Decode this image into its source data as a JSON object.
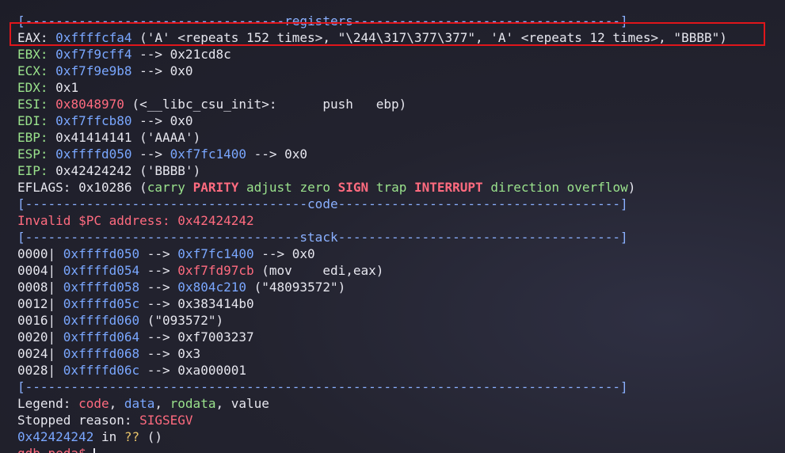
{
  "colors": {
    "background": "#23232f",
    "text": "#e6e6ee",
    "blue": "#7aa7ff",
    "header": "#8ab0ff",
    "red": "#ff6b7f",
    "green": "#9ae28c",
    "yellow": "#e9c46a",
    "highlight_box": "#e0161b"
  },
  "sections": {
    "registers": "[----------------------------------registers-----------------------------------]",
    "code": "[-------------------------------------code-------------------------------------]",
    "stack": "[------------------------------------stack-------------------------------------]",
    "end": "[------------------------------------------------------------------------------]"
  },
  "registers": {
    "eax": {
      "label": "EAX: ",
      "value": "0xffffcfa4",
      "desc": " ('A' <repeats 152 times>, \"\\244\\317\\377\\377\", 'A' <repeats 12 times>, \"BBBB\")"
    },
    "ebx": {
      "label": "EBX: ",
      "value": "0xf7f9cff4",
      "desc": " --> 0x21cd8c"
    },
    "ecx": {
      "label": "ECX: ",
      "value": "0xf7f9e9b8",
      "desc": " --> 0x0"
    },
    "edx": {
      "label": "EDX: ",
      "value": "0x1"
    },
    "esi": {
      "label": "ESI: ",
      "value": "0x8048970",
      "desc": " (<__libc_csu_init>:      push   ebp)"
    },
    "edi": {
      "label": "EDI: ",
      "value": "0xf7ffcb80",
      "desc": " --> 0x0"
    },
    "ebp": {
      "label": "EBP: ",
      "value": "0x41414141 ('AAAA')"
    },
    "esp": {
      "label": "ESP: ",
      "value": "0xffffd050",
      "arrow1": " --> ",
      "value2": "0xf7fc1400",
      "desc": " --> 0x0"
    },
    "eip": {
      "label": "EIP: ",
      "value": "0x42424242 ('BBBB')"
    },
    "eflags": {
      "label": "EFLAGS: ",
      "value": "0x10286 (",
      "flags": [
        "carry",
        "PARITY",
        "adjust",
        "zero",
        "SIGN",
        "trap",
        "INTERRUPT",
        "direction",
        "overflow"
      ],
      "close": ")"
    }
  },
  "code": {
    "message": "Invalid $PC address: 0x42424242"
  },
  "stack": [
    {
      "offset": "0000| ",
      "addr": "0xffffd050",
      "arrow": " --> ",
      "val": "0xf7fc1400",
      "rest": " --> 0x0"
    },
    {
      "offset": "0004| ",
      "addr": "0xffffd054",
      "arrow": " --> ",
      "val": "0xf7fd97cb",
      "rest": " (mov    edi,eax)"
    },
    {
      "offset": "0008| ",
      "addr": "0xffffd058",
      "arrow": " --> ",
      "val": "0x804c210",
      "rest": " (\"48093572\")"
    },
    {
      "offset": "0012| ",
      "addr": "0xffffd05c",
      "rest": " --> 0x383414b0"
    },
    {
      "offset": "0016| ",
      "addr": "0xffffd060",
      "rest": " (\"093572\")"
    },
    {
      "offset": "0020| ",
      "addr": "0xffffd064",
      "rest": " --> 0xf7003237"
    },
    {
      "offset": "0024| ",
      "addr": "0xffffd068",
      "rest": " --> 0x3"
    },
    {
      "offset": "0028| ",
      "addr": "0xffffd06c",
      "rest": " --> 0xa000001"
    }
  ],
  "legend": {
    "label": "Legend: ",
    "code": "code",
    "sep": ", ",
    "data": "data",
    "rodata": "rodata",
    "value": "value"
  },
  "stopped": {
    "label": "Stopped reason: ",
    "value": "SIGSEGV"
  },
  "location": {
    "addr": "0x42424242",
    "in": " in ",
    "func": "??",
    "args": " ()"
  },
  "prompt": "gdb-peda$ "
}
